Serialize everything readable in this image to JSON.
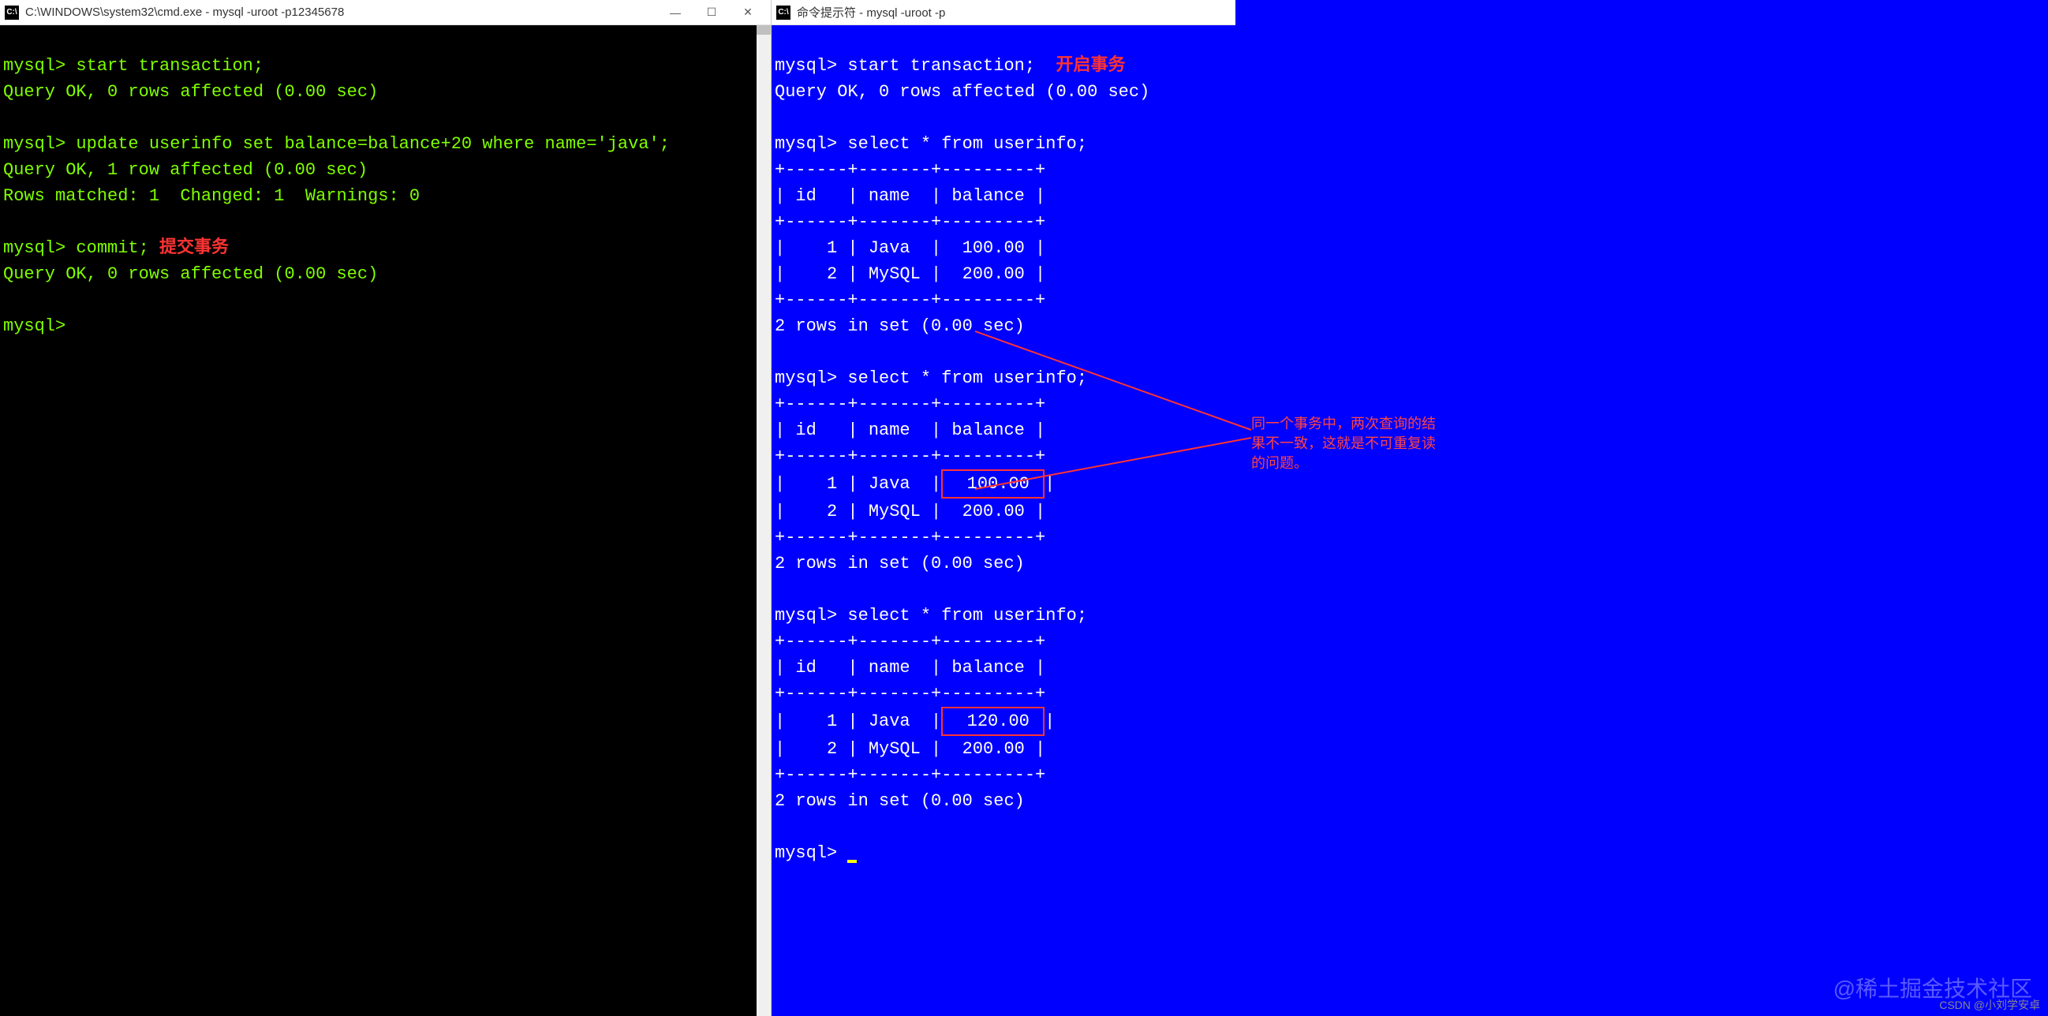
{
  "left_window": {
    "title": "C:\\WINDOWS\\system32\\cmd.exe - mysql  -uroot -p12345678",
    "icon_label": "cmd",
    "lines": {
      "l1": "mysql> start transaction;",
      "l2": "Query OK, 0 rows affected (0.00 sec)",
      "l3": "",
      "l4": "mysql> update userinfo set balance=balance+20 where name='java';",
      "l5": "Query OK, 1 row affected (0.00 sec)",
      "l6": "Rows matched: 1  Changed: 1  Warnings: 0",
      "l7": "",
      "l8_cmd": "mysql> commit;",
      "l8_anno": " 提交事务",
      "l9": "Query OK, 0 rows affected (0.00 sec)",
      "l10": "",
      "l11": "mysql>"
    }
  },
  "right_window": {
    "title": "命令提示符 - mysql  -uroot -p",
    "icon_label": "cmd",
    "anno_open": "开启事务",
    "lines": {
      "l1": "mysql> start transaction;",
      "l2": "Query OK, 0 rows affected (0.00 sec)",
      "l3": "",
      "l4": "mysql> select * from userinfo;",
      "sep": "+------+-------+---------+",
      "hdr": "| id   | name  | balance |",
      "t1r1": "|    1 | Java  |  100.00 |",
      "t1r2": "|    2 | MySQL |  200.00 |",
      "rows_set": "2 rows in set (0.00 sec)",
      "l_sel2": "mysql> select * from userinfo;",
      "t2r1a": "|    1 | Java  |",
      "t2r1b": "  100.00 ",
      "t2r1c": "|",
      "t2r2": "|    2 | MySQL |  200.00 |",
      "l_sel3": "mysql> select * from userinfo;",
      "t3r1a": "|    1 | Java  |",
      "t3r1b": "  120.00 ",
      "t3r1c": "|",
      "t3r2": "|    2 | MySQL |  200.00 |",
      "final_prompt": "mysql> "
    },
    "right_annotation": "同一个事务中，两次查询的结果不一致，这就是不可重复读的问题。"
  },
  "tables": {
    "headers": [
      "id",
      "name",
      "balance"
    ],
    "query1": [
      {
        "id": 1,
        "name": "Java",
        "balance": "100.00"
      },
      {
        "id": 2,
        "name": "MySQL",
        "balance": "200.00"
      }
    ],
    "query2": [
      {
        "id": 1,
        "name": "Java",
        "balance": "100.00"
      },
      {
        "id": 2,
        "name": "MySQL",
        "balance": "200.00"
      }
    ],
    "query3": [
      {
        "id": 1,
        "name": "Java",
        "balance": "120.00"
      },
      {
        "id": 2,
        "name": "MySQL",
        "balance": "200.00"
      }
    ]
  },
  "watermark": "@稀土掘金技术社区",
  "csdn": "CSDN @小刘学安卓",
  "window_controls": {
    "minimize": "—",
    "maximize": "☐",
    "close": "✕"
  }
}
